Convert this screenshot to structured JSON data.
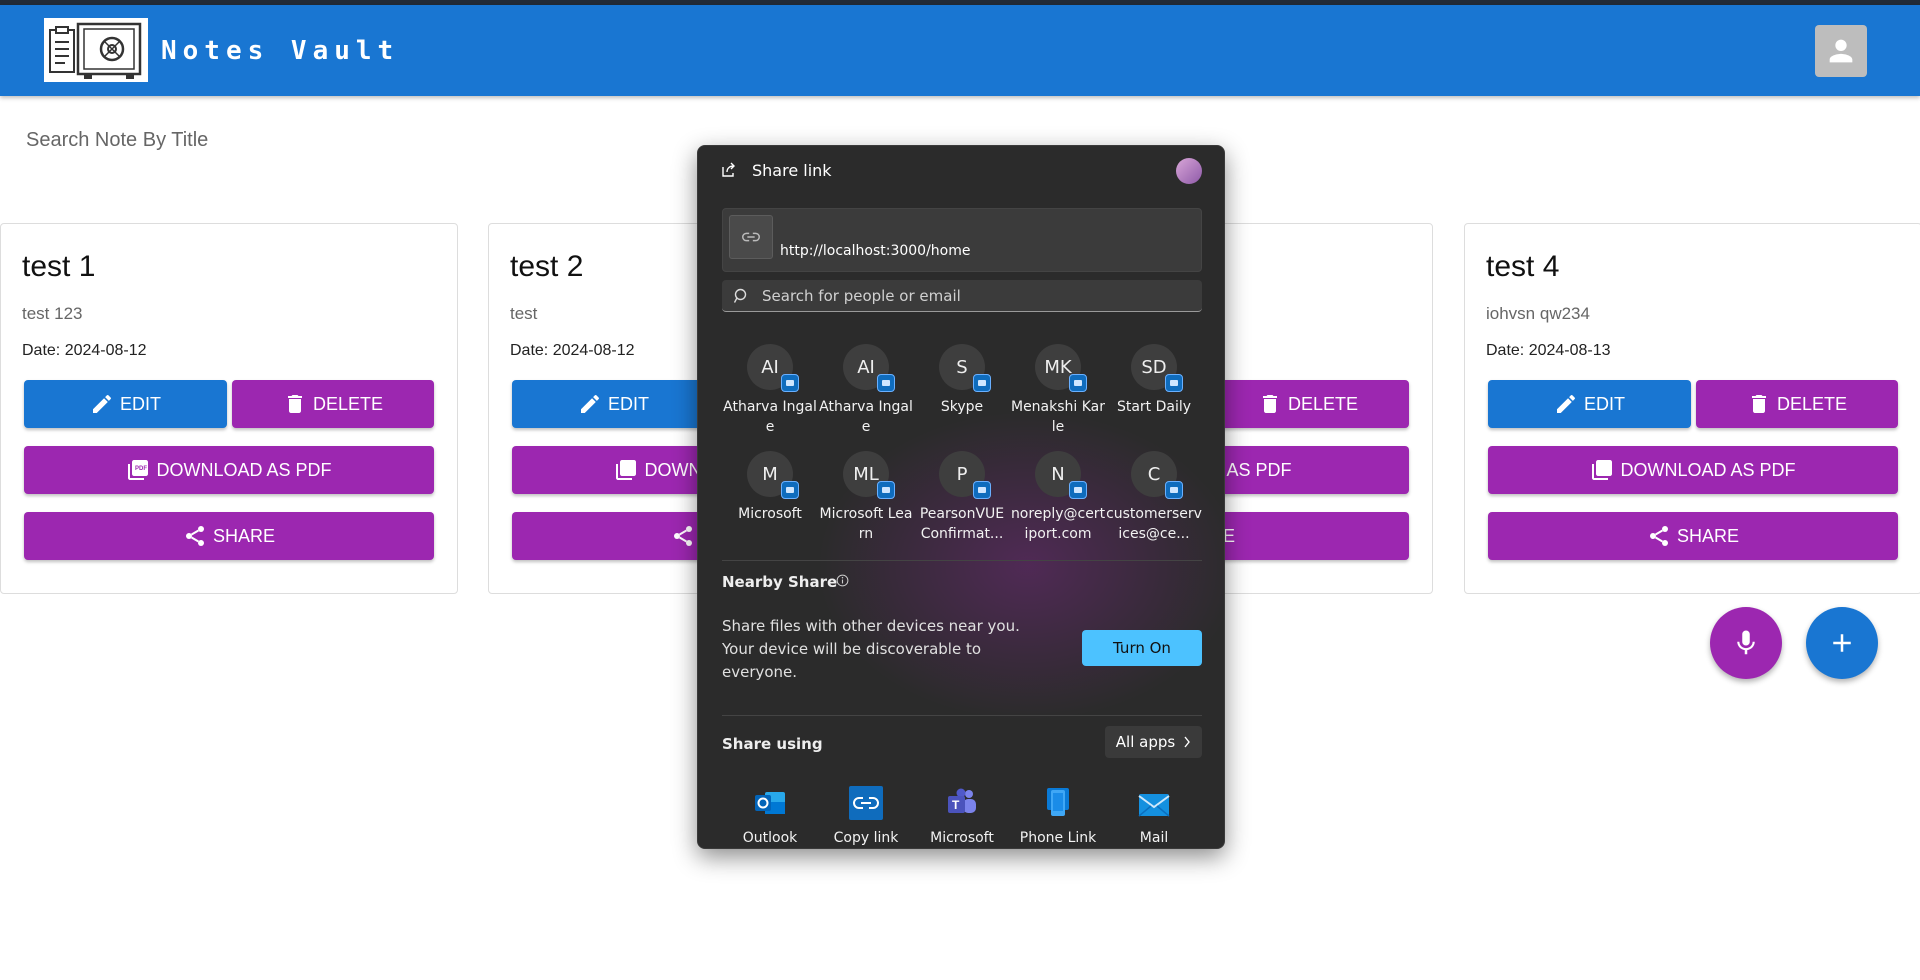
{
  "app": {
    "brand": "Notes Vault"
  },
  "search": {
    "placeholder": "Search Note By Title"
  },
  "cards": [
    {
      "title": "test 1",
      "body": "test 123",
      "date": "Date: 2024-08-12"
    },
    {
      "title": "test 2",
      "body": "test",
      "date": "Date: 2024-08-12"
    },
    {
      "title": "",
      "body": "",
      "date": ""
    },
    {
      "title": "test 4",
      "body": "iohvsn qw234",
      "date": "Date: 2024-08-13"
    }
  ],
  "card_buttons": {
    "edit": "EDIT",
    "delete": "DELETE",
    "pdf": "DOWNLOAD AS PDF",
    "share": "SHARE"
  },
  "share_dialog": {
    "title": "Share link",
    "url": "http://localhost:3000/home",
    "search_placeholder": "Search for people or email",
    "contacts": [
      {
        "initials": "AI",
        "name": "Atharva Ingale"
      },
      {
        "initials": "AI",
        "name": "Atharva Ingale"
      },
      {
        "initials": "S",
        "name": "Skype"
      },
      {
        "initials": "MK",
        "name": "Menakshi Karle"
      },
      {
        "initials": "SD",
        "name": "Start Daily"
      },
      {
        "initials": "M",
        "name": "Microsoft"
      },
      {
        "initials": "ML",
        "name": "Microsoft Learn"
      },
      {
        "initials": "P",
        "name": "PearsonVUE Confirmat..."
      },
      {
        "initials": "N",
        "name": "noreply@certiport.com"
      },
      {
        "initials": "C",
        "name": "customerservices@ce..."
      }
    ],
    "nearby_title": "Nearby Share",
    "nearby_desc": "Share files with other devices near you. Your device will be discoverable to everyone.",
    "turn_on": "Turn On",
    "share_using": "Share using",
    "all_apps": "All apps",
    "apps": [
      {
        "name": "Outlook",
        "icon": "outlook-icon"
      },
      {
        "name": "Copy link",
        "icon": "copy-link-icon"
      },
      {
        "name": "Microsoft",
        "icon": "teams-icon"
      },
      {
        "name": "Phone Link",
        "icon": "phone-link-icon"
      },
      {
        "name": "Mail",
        "icon": "mail-icon"
      }
    ]
  },
  "colors": {
    "appbar": "#1976d2",
    "primary": "#1976d2",
    "secondary": "#9c27b0",
    "dialog_bg": "#2b2b2b",
    "accent": "#4cc2ff"
  }
}
